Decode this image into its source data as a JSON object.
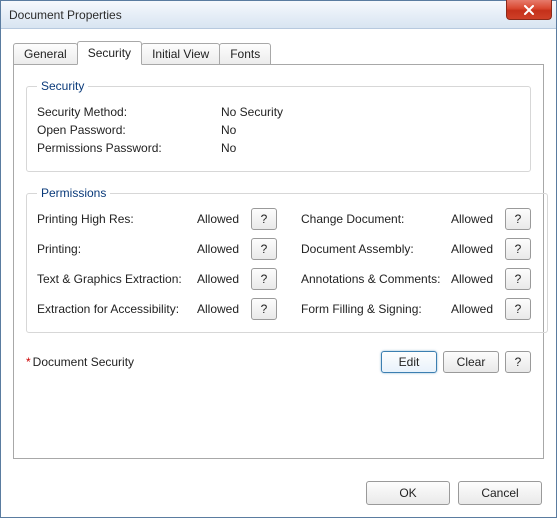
{
  "window": {
    "title": "Document Properties"
  },
  "tabs": {
    "general": "General",
    "security": "Security",
    "initial_view": "Initial View",
    "fonts": "Fonts"
  },
  "security_group": {
    "legend": "Security",
    "method_label": "Security Method:",
    "method_value": "No Security",
    "open_pw_label": "Open Password:",
    "open_pw_value": "No",
    "perm_pw_label": "Permissions Password:",
    "perm_pw_value": "No"
  },
  "permissions_group": {
    "legend": "Permissions",
    "rows_left": [
      {
        "label": "Printing High Res:",
        "value": "Allowed",
        "btn": "?"
      },
      {
        "label": "Printing:",
        "value": "Allowed",
        "btn": "?"
      },
      {
        "label": "Text & Graphics Extraction:",
        "value": "Allowed",
        "btn": "?"
      },
      {
        "label": "Extraction for Accessibility:",
        "value": "Allowed",
        "btn": "?"
      }
    ],
    "rows_right": [
      {
        "label": "Change Document:",
        "value": "Allowed",
        "btn": "?"
      },
      {
        "label": "Document Assembly:",
        "value": "Allowed",
        "btn": "?"
      },
      {
        "label": "Annotations & Comments:",
        "value": "Allowed",
        "btn": "?"
      },
      {
        "label": "Form Filling & Signing:",
        "value": "Allowed",
        "btn": "?"
      }
    ]
  },
  "docsec": {
    "asterisk": "*",
    "label": "Document Security",
    "edit": "Edit",
    "clear": "Clear",
    "help": "?"
  },
  "footer": {
    "ok": "OK",
    "cancel": "Cancel"
  }
}
